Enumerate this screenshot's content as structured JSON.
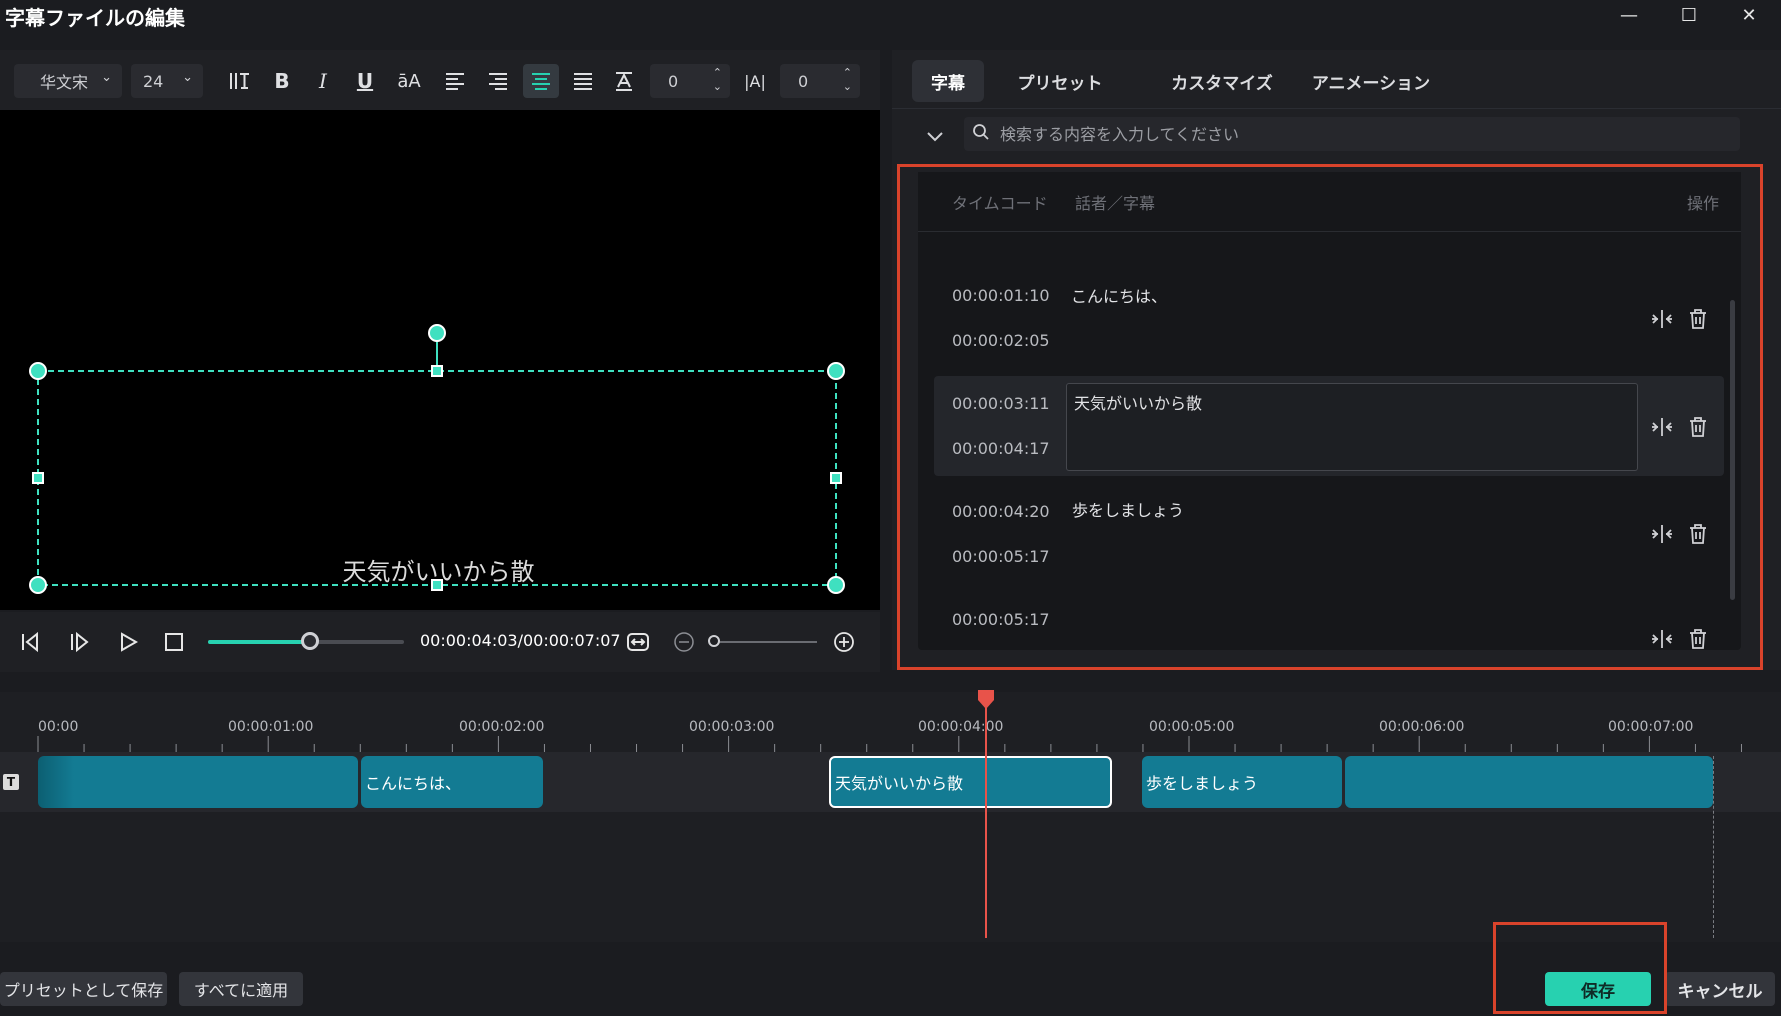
{
  "window": {
    "title": "字幕ファイルの編集",
    "minimize_glyph": "—",
    "maximize_glyph": "☐",
    "close_glyph": "✕"
  },
  "toolbar": {
    "font_family": "华文宋",
    "font_size": "24",
    "letter_spacing_value": "0",
    "line_spacing_value": "0",
    "icons": [
      "text-columns-icon",
      "bold-icon",
      "italic-icon",
      "underline-icon",
      "text-case-icon",
      "align-left-icon",
      "align-right-icon",
      "align-center-icon",
      "align-justify-icon",
      "text-baseline-icon",
      "letter-spacing-icon"
    ],
    "bold_glyph": "B",
    "italic_glyph": "I",
    "underline_glyph": "U",
    "case_glyph": "āA",
    "spacing_glyph": "|A|"
  },
  "preview": {
    "caption_text": "天気がいいから散"
  },
  "player": {
    "timecode": "00:00:04:03/00:00:07:07",
    "progress_fraction": 0.52
  },
  "tabs": [
    {
      "label": "字幕",
      "active": true
    },
    {
      "label": "プリセット",
      "active": false
    },
    {
      "label": "カスタマイズ",
      "active": false
    },
    {
      "label": "アニメーション",
      "active": false
    }
  ],
  "search": {
    "placeholder": "検索する内容を入力してください"
  },
  "subtitle_list": {
    "headers": {
      "timecode": "タイムコード",
      "speaker_caption": "話者／字幕",
      "actions": "操作"
    },
    "clipped_top_time": "00:00:01:10",
    "rows": [
      {
        "start": "00:00:01:10",
        "end": "00:00:02:05",
        "text": "こんにちは、",
        "selected": false
      },
      {
        "start": "00:00:03:11",
        "end": "00:00:04:17",
        "text": "天気がいいから散",
        "selected": true
      },
      {
        "start": "00:00:04:20",
        "end": "00:00:05:17",
        "text": "歩をしましょう",
        "selected": false
      },
      {
        "start": "00:00:05:17",
        "end": "",
        "text": "",
        "selected": false
      }
    ]
  },
  "timeline": {
    "ticks": [
      "00:00",
      "00:00:01:00",
      "00:00:02:00",
      "00:00:03:00",
      "00:00:04:00",
      "00:00:05:00",
      "00:00:06:00",
      "00:00:07:00"
    ],
    "track_icon": "T",
    "clips": [
      {
        "label": ""
      },
      {
        "label": "こんにちは、"
      },
      {
        "label": "天気がいいから散"
      },
      {
        "label": "歩をしましょう"
      },
      {
        "label": ""
      }
    ]
  },
  "footer": {
    "save_as_preset": "プリセットとして保存",
    "apply_all": "すべてに適用",
    "save": "保存",
    "cancel": "キャンセル"
  },
  "colors": {
    "accent": "#27d1b0",
    "clip": "#137b93",
    "playhead": "#e8534a",
    "highlight_box": "#d9432b",
    "background": "#1b1c20"
  }
}
